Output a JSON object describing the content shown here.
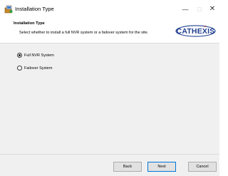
{
  "window": {
    "title": "Installation Type",
    "controls": {
      "minimize": "—",
      "maximize": "□",
      "close": "✕"
    }
  },
  "header": {
    "title": "Installation Type",
    "subtitle": "Select whether to install a full NVR system or a failover system for the site.",
    "logo_text": "CATHEXIS",
    "logo_color": "#1f3f8f",
    "logo_accent": "#d42a2a"
  },
  "options": [
    {
      "label": "Full NVR System",
      "selected": true
    },
    {
      "label": "Failover System",
      "selected": false
    }
  ],
  "footer": {
    "back_label": "Back",
    "next_label": "Next",
    "cancel_label": "Cancel"
  }
}
